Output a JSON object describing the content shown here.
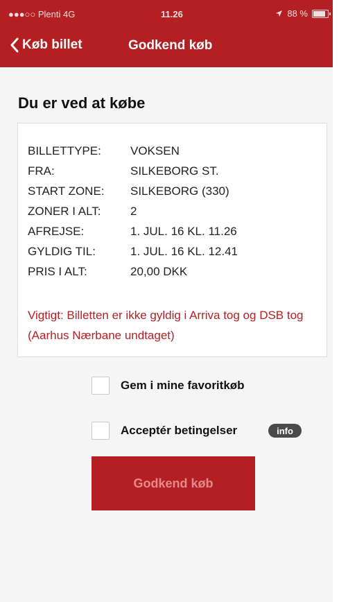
{
  "status_bar": {
    "carrier": "●●●○○ Plenti  4G",
    "time": "11.26",
    "battery": "88 %",
    "location_icon": "location-arrow-icon"
  },
  "nav": {
    "back_label": "Køb billet",
    "back_icon": "chevron-left-icon",
    "title": "Godkend køb"
  },
  "heading": "Du er ved at købe",
  "ticket": {
    "rows": [
      {
        "label": "BILLETTYPE:",
        "value": "VOKSEN"
      },
      {
        "label": "FRA:",
        "value": "SILKEBORG ST."
      },
      {
        "label": "START ZONE:",
        "value": "SILKEBORG (330)"
      },
      {
        "label": "ZONER I ALT:",
        "value": "2"
      },
      {
        "label": "AFREJSE:",
        "value": "1. JUL. 16 KL. 11.26"
      },
      {
        "label": "GYLDIG TIL:",
        "value": "1. JUL. 16 KL. 12.41"
      },
      {
        "label": "PRIS I ALT:",
        "value": "20,00 DKK"
      }
    ],
    "warning": "Vigtigt: Billetten er ikke gyldig i Arriva tog og DSB tog (Aarhus Nærbane undtaget)"
  },
  "options": {
    "favorite_label": "Gem i mine favoritkøb",
    "favorite_checked": false,
    "accept_label": "Acceptér betingelser",
    "accept_checked": false,
    "info_label": "info"
  },
  "confirm_button": "Godkend køb",
  "colors": {
    "brand": "#b41f24",
    "warning_text": "#b41f24",
    "button_text_disabled": "#e58a8c"
  }
}
